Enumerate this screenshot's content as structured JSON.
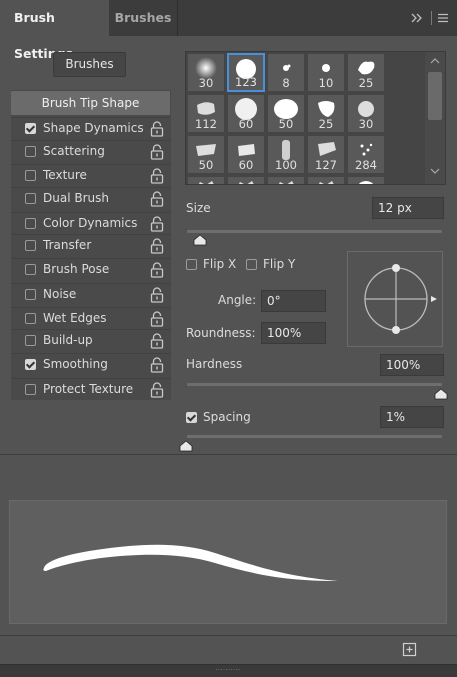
{
  "tabs": {
    "active": "Brush Settings",
    "inactive": "Brushes"
  },
  "icons": {
    "collapse": "double-chevron-right-icon",
    "menu": "hamburger-menu-icon",
    "lock": "lock-open-icon",
    "new_preset": "new-brush-preset-icon"
  },
  "brushes_button": "Brushes",
  "options": {
    "tip_shape": "Brush Tip Shape",
    "items": [
      {
        "label": "Shape Dynamics",
        "checked": true
      },
      {
        "label": "Scattering",
        "checked": false
      },
      {
        "label": "Texture",
        "checked": false
      },
      {
        "label": "Dual Brush",
        "checked": false
      },
      {
        "label": "Color Dynamics",
        "checked": false
      },
      {
        "label": "Transfer",
        "checked": false
      },
      {
        "label": "Brush Pose",
        "checked": false
      },
      {
        "label": "Noise",
        "checked": false
      },
      {
        "label": "Wet Edges",
        "checked": false
      },
      {
        "label": "Build-up",
        "checked": false
      },
      {
        "label": "Smoothing",
        "checked": true
      },
      {
        "label": "Protect Texture",
        "checked": false
      }
    ]
  },
  "presets": {
    "row1": [
      "30",
      "123",
      "8",
      "10",
      "25"
    ],
    "row2": [
      "112",
      "60",
      "50",
      "25",
      "30"
    ],
    "row3": [
      "50",
      "60",
      "100",
      "127",
      "284"
    ],
    "selected": "123"
  },
  "size": {
    "label": "Size",
    "value": "12 px"
  },
  "flip_x": {
    "label": "Flip X",
    "checked": false
  },
  "flip_y": {
    "label": "Flip Y",
    "checked": false
  },
  "angle": {
    "label": "Angle:",
    "value": "0°"
  },
  "roundness": {
    "label": "Roundness:",
    "value": "100%"
  },
  "hardness": {
    "label": "Hardness",
    "value": "100%"
  },
  "spacing": {
    "label": "Spacing",
    "value": "1%",
    "checked": true
  },
  "colors": {
    "panel": "#535353",
    "tabbar": "#3c3c3c",
    "selection": "#4a90d9"
  }
}
